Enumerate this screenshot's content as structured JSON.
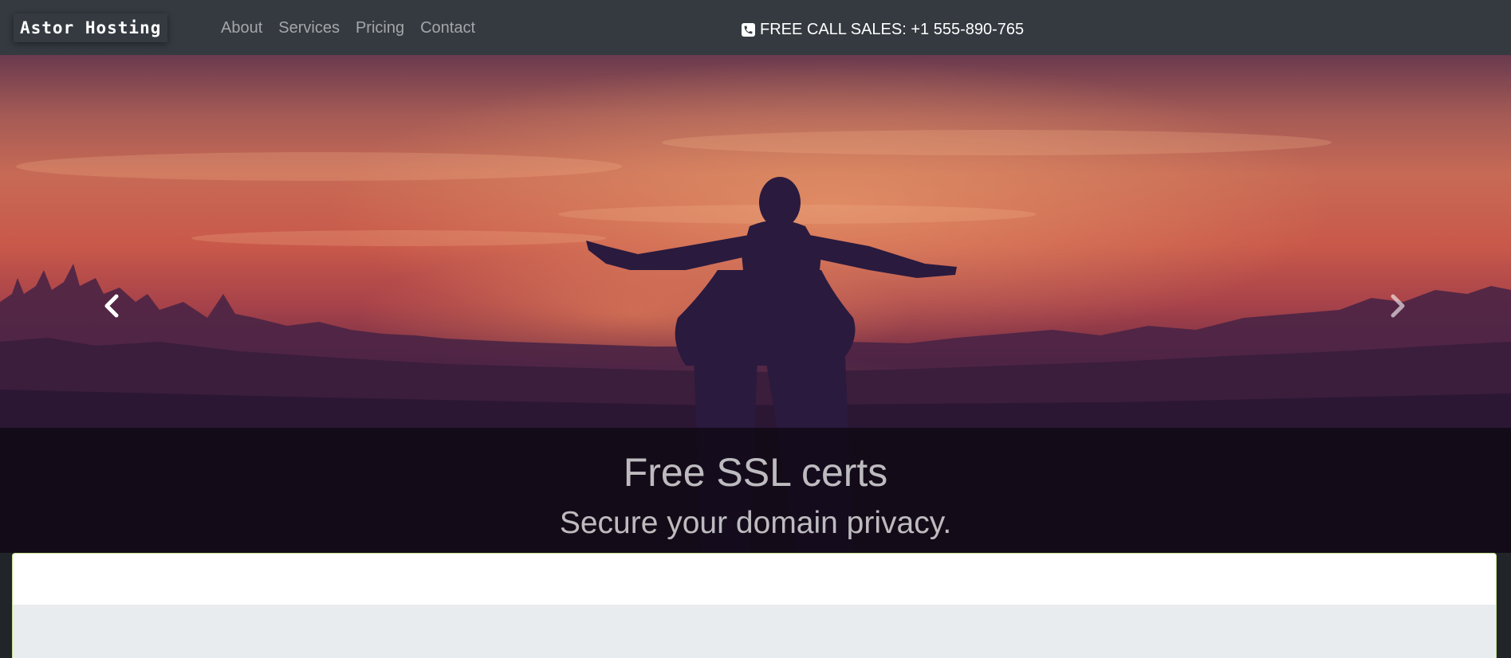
{
  "navbar": {
    "brand": "Astor Hosting",
    "links": [
      "About",
      "Services",
      "Pricing",
      "Contact"
    ],
    "call_text": "FREE CALL SALES: +1 555-890-765",
    "call_icon": "phone-icon"
  },
  "carousel": {
    "caption_title": "Free SSL certs",
    "caption_subtitle": "Secure your domain privacy.",
    "prev_icon": "chevron-left-icon",
    "next_icon": "chevron-right-icon"
  },
  "colors": {
    "navbar_bg": "#343a40",
    "page_bg": "#212529",
    "card_border": "#c5e08a",
    "card_lower_bg": "#e8ecef"
  }
}
